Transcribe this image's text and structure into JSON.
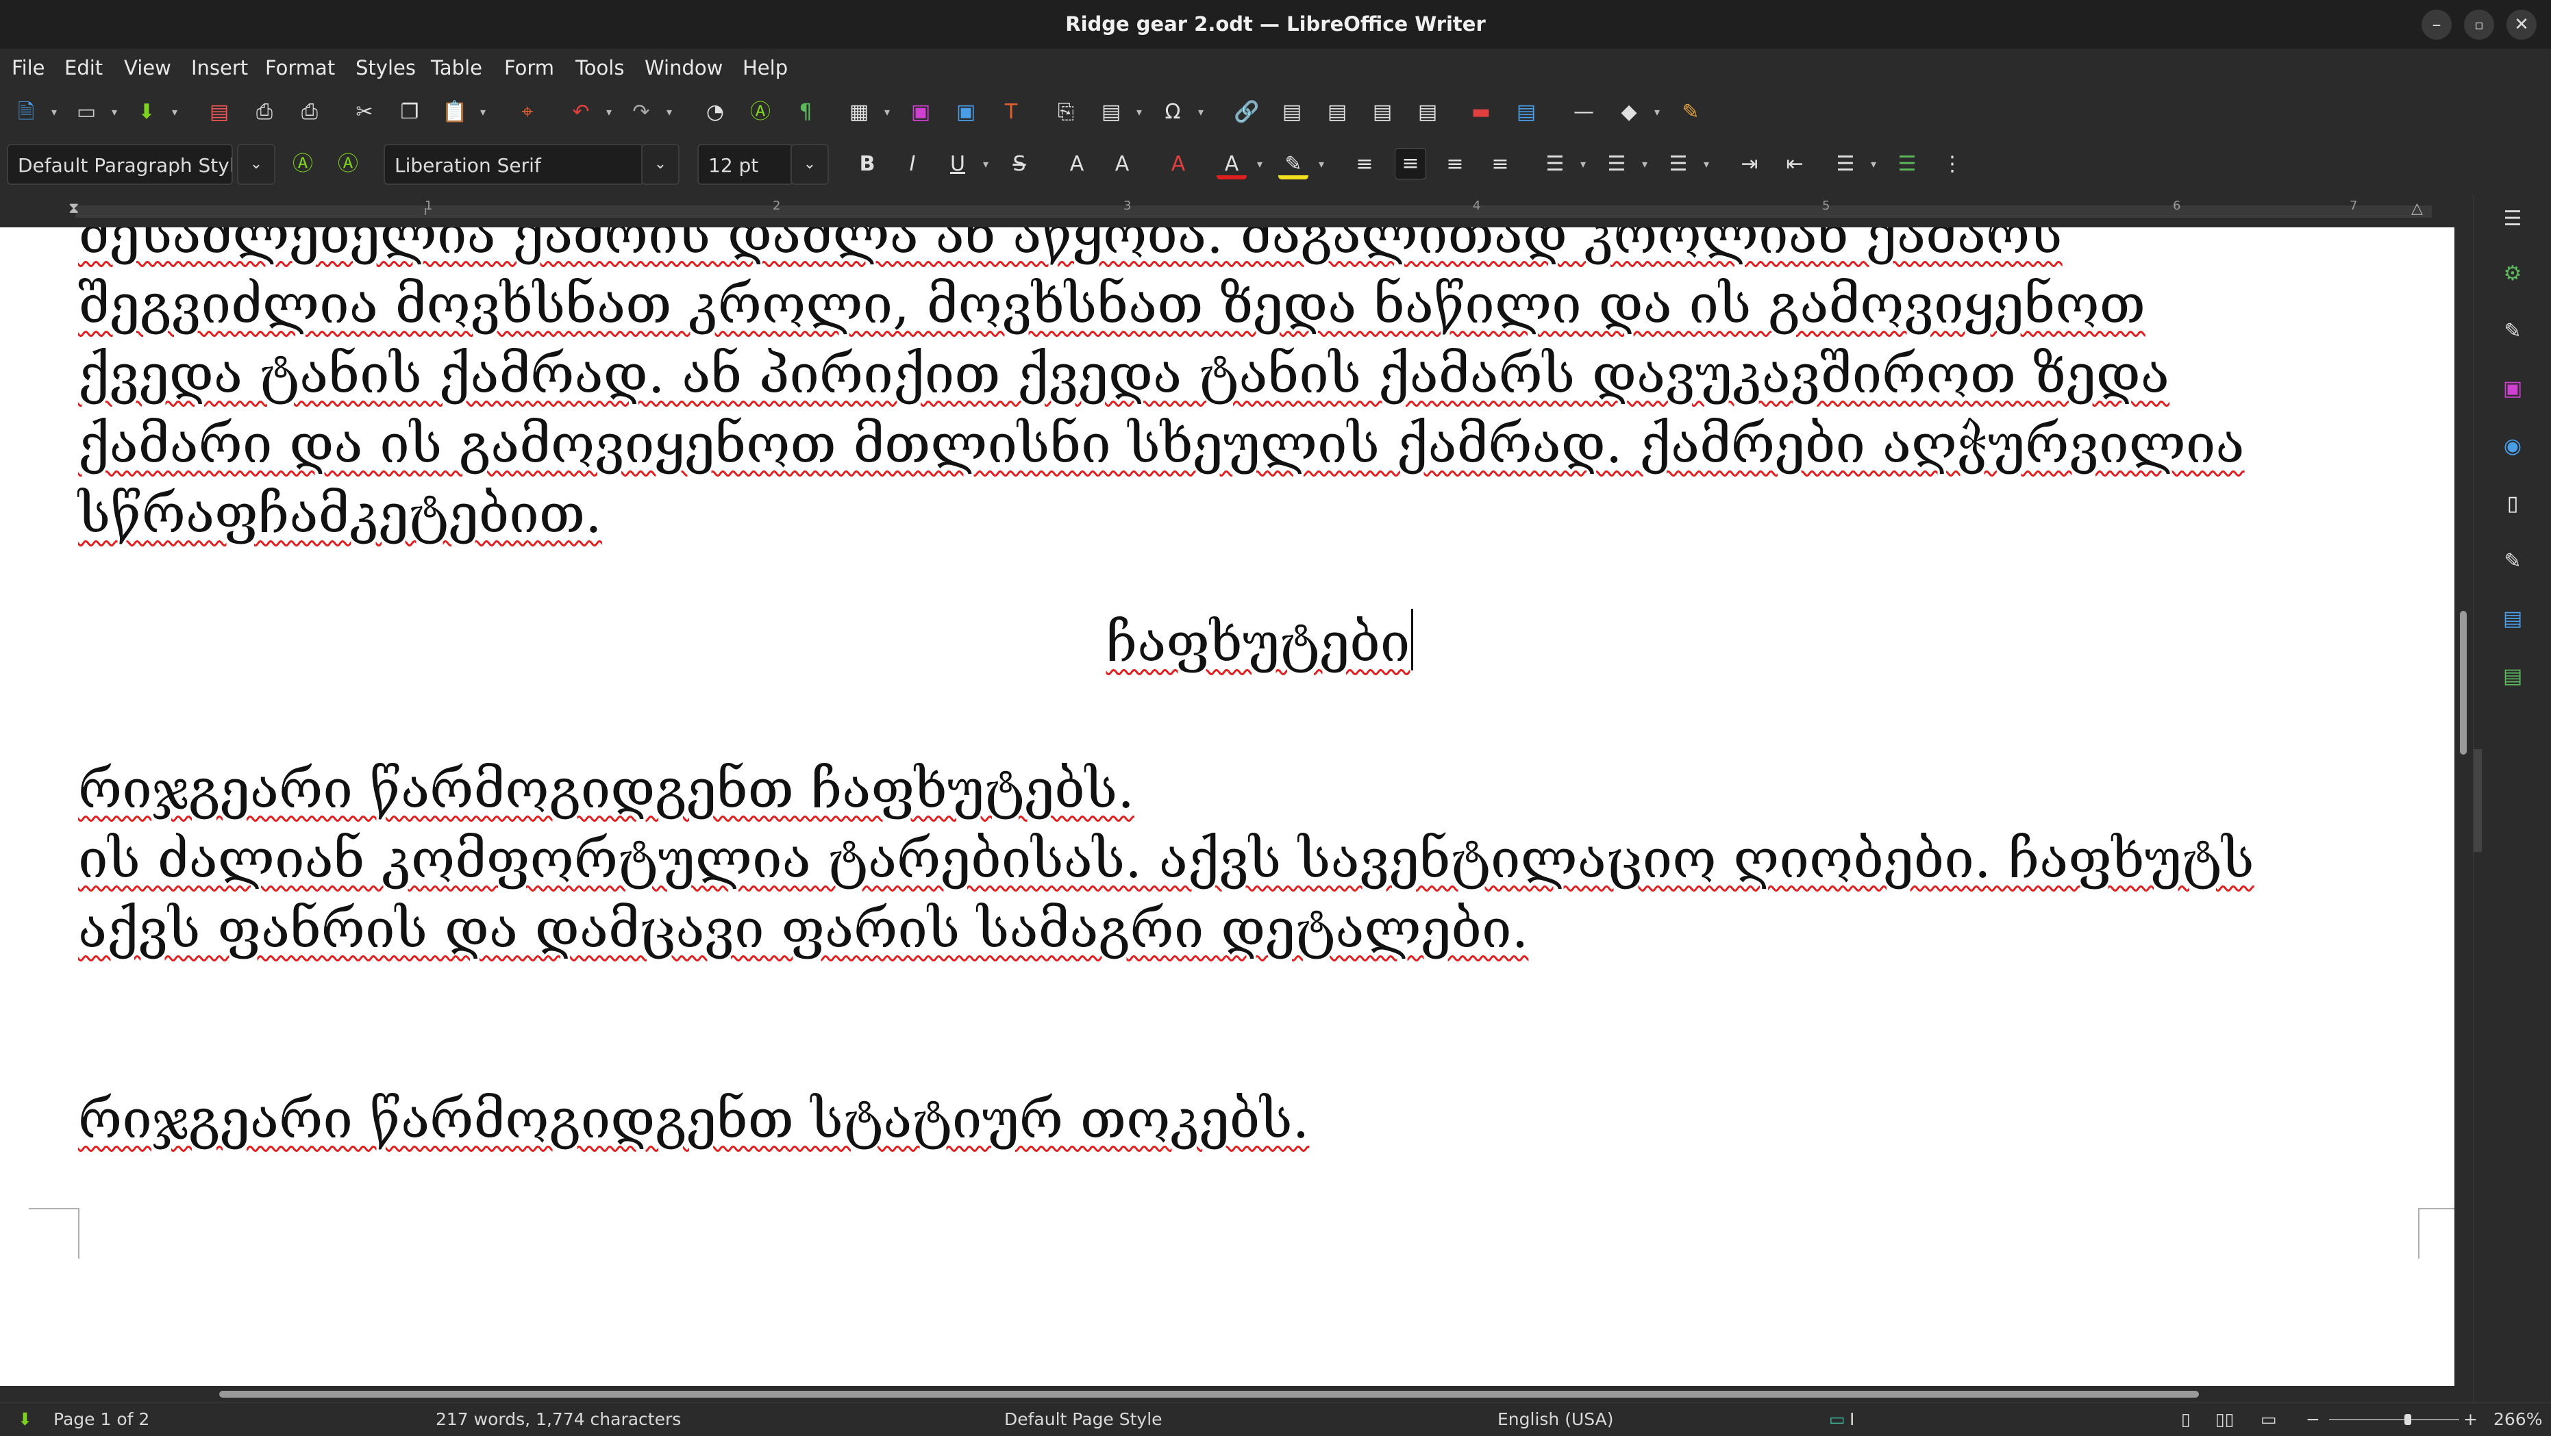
{
  "window": {
    "title": "Ridge gear 2.odt — LibreOffice Writer"
  },
  "menu": [
    "File",
    "Edit",
    "View",
    "Insert",
    "Format",
    "Styles",
    "Table",
    "Form",
    "Tools",
    "Window",
    "Help"
  ],
  "formatting": {
    "paragraph_style": "Default Paragraph Styl",
    "font_name": "Liberation Serif",
    "font_size": "12 pt"
  },
  "ruler": {
    "numbers": [
      "1",
      "1",
      "2",
      "3",
      "4",
      "5",
      "6",
      "7"
    ]
  },
  "document": {
    "lines_top": [
      "შესაძლებელია ქამრის დაშლა ან აწყობა. მაგალითად კროლიან ქამარს",
      "შეგვიძლია მოვხსნათ კროლი, მოვხსნათ ზედა ნაწილი და ის გამოვიყენოთ",
      "ქვედა ტანის ქამრად. ან პირიქით ქვედა ტანის ქამარს დავუკავშიროთ ზედა",
      "ქამარი და ის გამოვიყენოთ მთლისნი სხეულის ქამრად. ქამრები აღჭურვილია",
      "სწრაფჩამკეტებით."
    ],
    "heading": "ჩაფხუტები",
    "lines_mid": [
      "რიჯგეარი წარმოგიდგენთ ჩაფხუტებს.",
      "ის ძალიან კომფორტულია ტარებისას. აქვს სავენტილაციო ღიობები. ჩაფხუტს",
      "აქვს ფანრის და დამცავი ფარის სამაგრი დეტალები."
    ],
    "line_bottom": "რიჯგეარი წარმოგიდგენთ სტატიურ თოკებს."
  },
  "status": {
    "page": "Page 1 of 2",
    "words": "217 words, 1,774 characters",
    "page_style": "Default Page Style",
    "language": "English (USA)",
    "zoom": "266%"
  }
}
